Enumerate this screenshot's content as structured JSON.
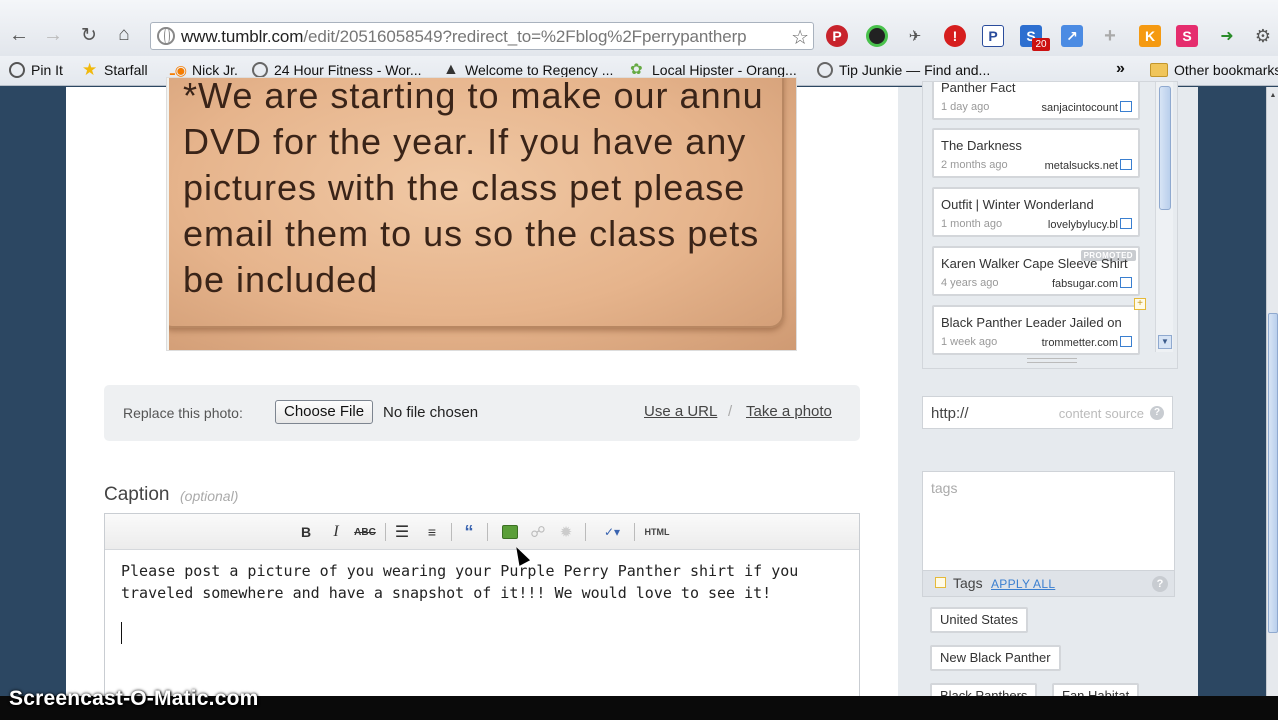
{
  "browser": {
    "url_host": "www.tumblr.com",
    "url_rest": "/edit/20516058549?redirect_to=%2Fblog%2Fperrypantherp",
    "bookmarks": [
      {
        "label": "Pin It",
        "icon": "pin-icon"
      },
      {
        "label": "Starfall",
        "icon": "star-icon"
      },
      {
        "label": "Nick Jr.",
        "icon": "nickjr-icon"
      },
      {
        "label": "24 Hour Fitness - Wor...",
        "icon": "globe-icon"
      },
      {
        "label": "Welcome to Regency ...",
        "icon": "regency-icon"
      },
      {
        "label": "Local Hipster - Orang...",
        "icon": "hipster-icon"
      },
      {
        "label": "Tip Junkie — Find and...",
        "icon": "globe-icon"
      }
    ],
    "bookmarks_more": "»",
    "other_bookmarks": "Other bookmarks",
    "extensions": {
      "pinterest": "P",
      "stop": "!",
      "p": "P",
      "s": "S",
      "s_badge": "20",
      "k": "K",
      "s2": "S"
    }
  },
  "photo": {
    "text": "*We are starting to make our annu\nDVD for the year. If you have any\npictures with the class pet please\nemail them to us so the class pets\nbe included"
  },
  "replace": {
    "label": "Replace this photo:",
    "choose_file": "Choose File",
    "no_file": "No file chosen",
    "use_url": "Use a URL",
    "separator": "/",
    "take_photo": "Take a photo"
  },
  "caption": {
    "title": "Caption",
    "optional": "(optional)",
    "toolbar": {
      "bold": "B",
      "italic": "I",
      "strike": "ABC",
      "html": "HTML"
    },
    "text": "Please post a picture of you wearing your Purple Perry Panther shirt if you traveled somewhere and have a snapshot of it!!! We would love to see it!"
  },
  "related": {
    "items": [
      {
        "title": "Panther Fact",
        "time": "1 day ago",
        "source": "sanjacintocount"
      },
      {
        "title": "The Darkness",
        "time": "2 months ago",
        "source": "metalsucks.net"
      },
      {
        "title": "Outfit | Winter Wonderland",
        "time": "1 month ago",
        "source": "lovelybylucy.bl"
      },
      {
        "title": "Karen Walker Cape Sleeve Shirt",
        "time": "4 years ago",
        "source": "fabsugar.com"
      },
      {
        "title": "Black Panther Leader Jailed on",
        "time": "1 week ago",
        "source": "trommetter.com"
      }
    ],
    "promoted": "PROMOTED"
  },
  "content_source": {
    "prefix": "http://",
    "label": "content source",
    "help": "?"
  },
  "tags": {
    "placeholder": "tags",
    "bar_label": "Tags",
    "apply_all": "APPLY ALL",
    "help": "?",
    "chips": [
      "United States",
      "New Black Panther",
      "Black Panthers",
      "Fan Habitat"
    ]
  },
  "watermark": "Screencast-O-Matic.com"
}
